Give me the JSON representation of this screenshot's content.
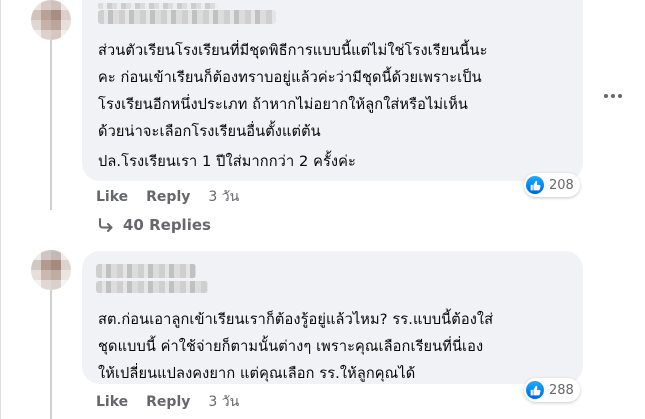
{
  "comments": [
    {
      "text": "ส่วนตัวเรียนโรงเรียนที่มีชุดพิธีการแบบนี้แต่ไม่ใช่โรงเรียนนี้นะ\nคะ ก่อนเข้าเรียนก็ต้องทราบอยู่แล้วค่ะว่ามีชุดนี้ด้วยเพราะเป็น\nโรงเรียนอีกหนึ่งประเภท ถ้าหากไม่อยากให้ลูกใส่หรือไม่เห็น\nด้วยน่าจะเลือกโรงเรียนอื่นตั้งแต่ต้น",
      "extra": "ปล.โรงเรียนเรา 1 ปีใส่มากกว่า 2 ครั้งค่ะ",
      "like_label": "Like",
      "reply_label": "Reply",
      "time": "3 วัน",
      "reaction_count": "208",
      "replies_label": "40 Replies"
    },
    {
      "text": "สต.ก่อนเอาลูกเข้าเรียนเราก็ต้องรู้อยู่แล้วไหม? รร.แบบนี้ต้องใส่\nชุดแบบนี้ ค่าใช้จ่ายก็ตามนั้นต่างๆ เพราะคุณเลือกเรียนที่นี่เอง\nให้เปลี่ยนแปลงคงยาก แต่คุณเลือก รร.ให้ลูกคุณได้",
      "like_label": "Like",
      "reply_label": "Reply",
      "time": "3 วัน",
      "reaction_count": "288"
    }
  ],
  "colors": {
    "bubble": "#f0f2f5",
    "meta": "#65676b",
    "like_blue": "#0866ff"
  },
  "icons": [
    "like-icon",
    "reply-arrow-icon",
    "more-options-icon"
  ]
}
